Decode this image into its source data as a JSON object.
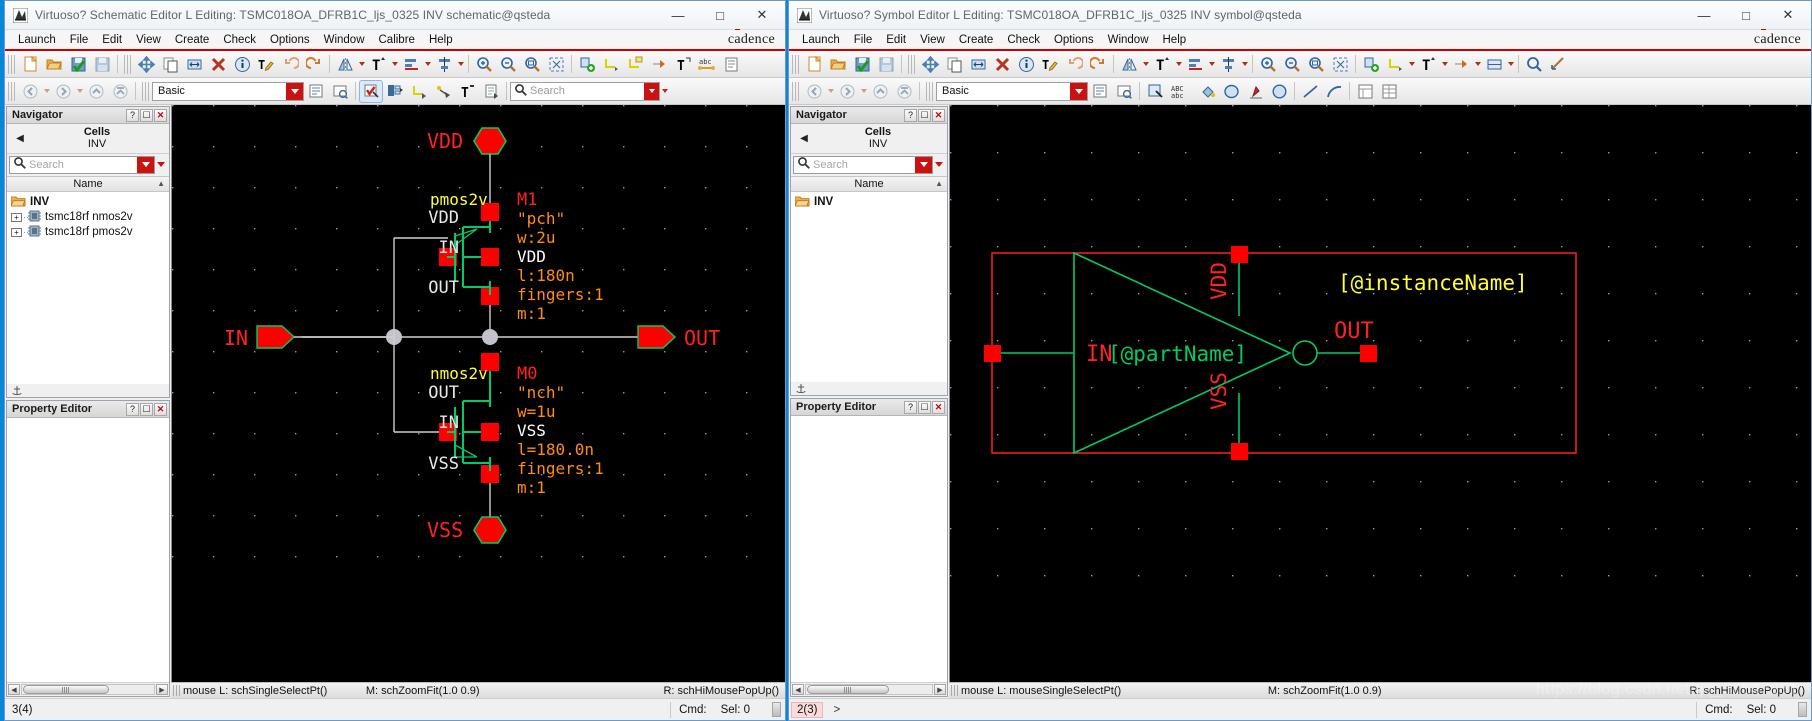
{
  "schematic_window": {
    "title": "Virtuoso? Schematic Editor L Editing: TSMC018OA_DFRB1C_ljs_0325 INV schematic@qsteda",
    "app_icon": "virtuoso-icon",
    "brand": "cadence",
    "window_buttons": {
      "minimize": "—",
      "maximize": "□",
      "close": "✕"
    },
    "menus": [
      "Launch",
      "File",
      "Edit",
      "View",
      "Create",
      "Check",
      "Options",
      "Window",
      "Calibre",
      "Help"
    ],
    "toolbar2": {
      "palette_value": "Basic",
      "search_placeholder": "Search"
    },
    "navigator": {
      "panel_title": "Navigator",
      "cells_label": "Cells",
      "cell_name": "INV",
      "search_placeholder": "Search",
      "column_header": "Name",
      "tree": [
        {
          "label": "INV",
          "type": "library-folder",
          "expandable": false,
          "indent": 0
        },
        {
          "label": "tsmc18rf nmos2v",
          "type": "cell",
          "expandable": true,
          "indent": 0
        },
        {
          "label": "tsmc18rf pmos2v",
          "type": "cell",
          "expandable": true,
          "indent": 0
        }
      ]
    },
    "property_editor": {
      "panel_title": "Property Editor"
    },
    "status": {
      "mouse_left": "mouse L: schSingleSelectPt()",
      "mouse_mid": "M: schZoomFit(1.0 0.9)",
      "mouse_right": "R: schHiMousePopUp()",
      "cmd_count": "3(4)",
      "cmd_label": "Cmd:",
      "sel_label": "Sel: 0"
    },
    "canvas": {
      "vdd_pin_label": "VDD",
      "vss_pin_label": "VSS",
      "in_pin_label": "IN",
      "out_pin_label": "OUT",
      "pmos": {
        "model_label": "pmos2v",
        "inst_name": "M1",
        "model": "\"pch\"",
        "width": "w:2u",
        "bulk": "VDD",
        "length": "l:180n",
        "fingers": "fingers:1",
        "mult": "m:1",
        "term_top": "VDD",
        "term_gate": "IN",
        "term_bottom": "OUT"
      },
      "nmos": {
        "model_label": "nmos2v",
        "inst_name": "M0",
        "model": "\"nch\"",
        "width": "w=1u",
        "bulk": "VSS",
        "length": "l=180.0n",
        "fingers": "fingers:1",
        "mult": "m:1",
        "term_top": "OUT",
        "term_gate": "IN",
        "term_bottom": "VSS"
      }
    }
  },
  "symbol_window": {
    "title": "Virtuoso? Symbol Editor L Editing: TSMC018OA_DFRB1C_ljs_0325 INV symbol@qsteda",
    "app_icon": "virtuoso-icon",
    "brand": "cadence",
    "window_buttons": {
      "minimize": "—",
      "maximize": "□",
      "close": "✕"
    },
    "menus": [
      "Launch",
      "File",
      "Edit",
      "View",
      "Create",
      "Check",
      "Options",
      "Window",
      "Help"
    ],
    "toolbar2": {
      "palette_value": "Basic",
      "abc_label": "ABC"
    },
    "navigator": {
      "panel_title": "Navigator",
      "cells_label": "Cells",
      "cell_name": "INV",
      "search_placeholder": "Search",
      "column_header": "Name",
      "tree": [
        {
          "label": "INV",
          "type": "library-folder",
          "expandable": false,
          "indent": 0
        }
      ]
    },
    "property_editor": {
      "panel_title": "Property Editor"
    },
    "status": {
      "mouse_left": "mouse L: mouseSingleSelectPt()",
      "mouse_mid": "M: schZoomFit(1.0 0.9)",
      "mouse_right": "R: schHiMousePopUp()",
      "cmd_count": "2(3)",
      "cmd_prompt": ">",
      "cmd_label": "Cmd:",
      "sel_label": "Sel: 0"
    },
    "canvas": {
      "in_label": "IN",
      "out_label": "OUT",
      "vdd_label": "VDD",
      "vss_label": "VSS",
      "part_name": "[@partName]",
      "instance_name": "[@instanceName]"
    }
  },
  "watermark": "https://blog.csdn.net/qq_36547861",
  "colors": {
    "accent_red": "#cc0000",
    "pin_red": "#ff0000",
    "wire_white": "#d9d9d9",
    "device_green": "#00cc66",
    "annot_orange": "#ff8c1a",
    "label_yellow": "#ffff33",
    "canvas_bg": "#000000",
    "desktop_blue": "#0a86d8"
  }
}
